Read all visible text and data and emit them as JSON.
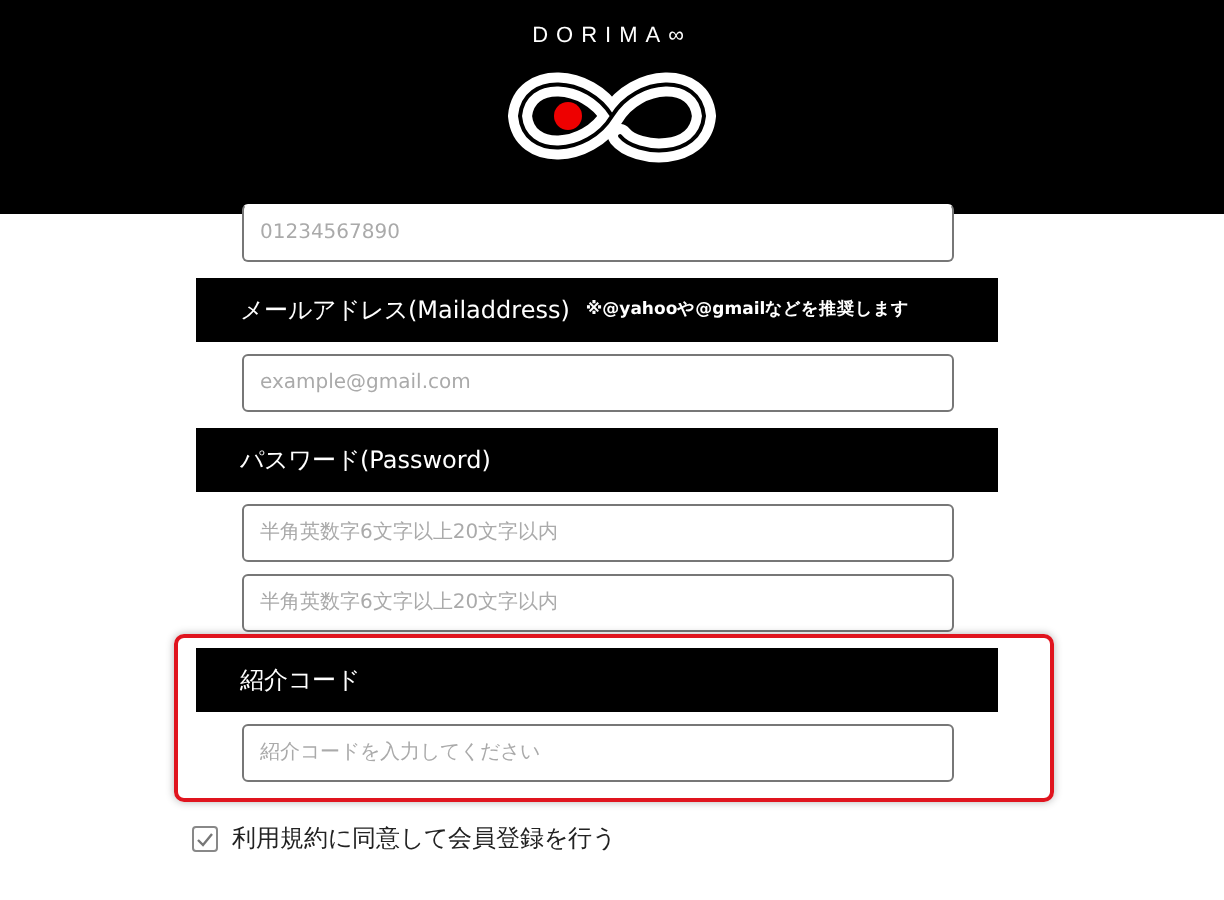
{
  "header": {
    "brand": "DORIMA∞"
  },
  "sections": [
    {
      "kind": "field",
      "placeholder": "01234567890"
    },
    {
      "kind": "heading",
      "label": "メールアドレス(Mailaddress)",
      "note": "※@yahooや@gmailなどを推奨します"
    },
    {
      "kind": "field",
      "placeholder": "example@gmail.com"
    },
    {
      "kind": "heading",
      "label": "パスワード(Password)"
    },
    {
      "kind": "field",
      "placeholder": "半角英数字6文字以上20文字以内"
    },
    {
      "kind": "field",
      "placeholder": "半角英数字6文字以上20文字以内"
    },
    {
      "kind": "group",
      "highlighted": true,
      "children": [
        {
          "kind": "heading",
          "label": "紹介コード"
        },
        {
          "kind": "field",
          "placeholder": "紹介コードを入力してください"
        }
      ]
    }
  ],
  "agreement": {
    "label": "利用規約に同意して会員登録を行う",
    "checked": true
  }
}
